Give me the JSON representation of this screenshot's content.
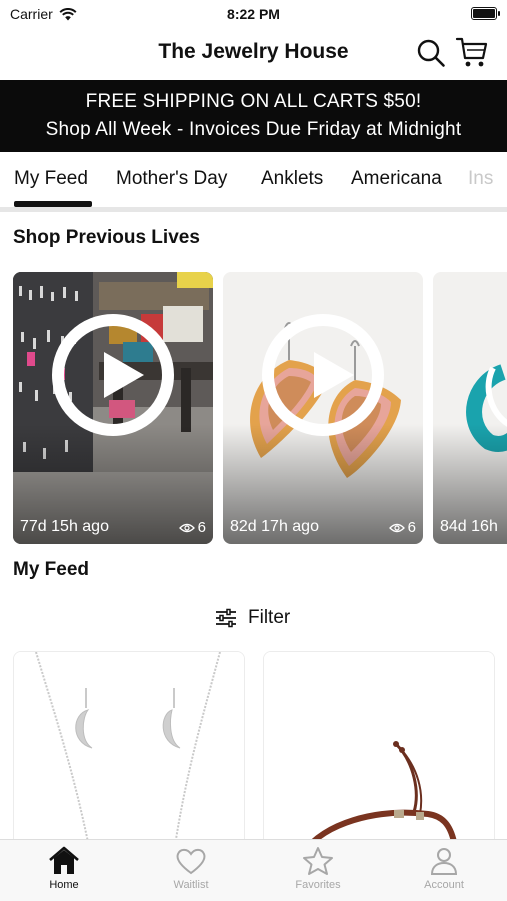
{
  "status_bar": {
    "carrier": "Carrier",
    "time": "8:22 PM"
  },
  "header": {
    "title": "The Jewelry House",
    "search_icon": "search-icon",
    "cart_icon": "cart-icon"
  },
  "banner": {
    "line1": "FREE SHIPPING ON ALL CARTS $50!",
    "line2": "Shop All Week - Invoices Due Friday at Midnight"
  },
  "tabs": [
    {
      "label": "My Feed",
      "active": true
    },
    {
      "label": "Mother's Day",
      "active": false
    },
    {
      "label": "Anklets",
      "active": false
    },
    {
      "label": "Americana",
      "active": false
    },
    {
      "label": "Ins",
      "active": false
    }
  ],
  "previous_lives": {
    "title": "Shop Previous Lives",
    "items": [
      {
        "ago": "77d 15h ago",
        "views": "6"
      },
      {
        "ago": "82d 17h ago",
        "views": "6"
      },
      {
        "ago": "84d 16h",
        "views": ""
      }
    ]
  },
  "feed": {
    "title": "My Feed",
    "filter_label": "Filter",
    "filter_icon": "sliders-icon"
  },
  "tab_bar": [
    {
      "label": "Home",
      "icon": "home-icon",
      "active": true
    },
    {
      "label": "Waitlist",
      "icon": "heart-icon",
      "active": false
    },
    {
      "label": "Favorites",
      "icon": "star-icon",
      "active": false
    },
    {
      "label": "Account",
      "icon": "person-icon",
      "active": false
    }
  ],
  "colors": {
    "banner_bg": "#0b0b0b",
    "accent": "#111111",
    "muted": "#a7a7a7"
  }
}
